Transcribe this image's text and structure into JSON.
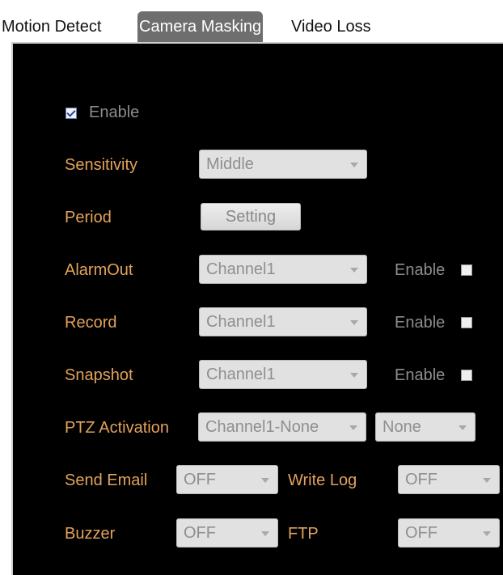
{
  "tabs": [
    {
      "label": "Motion Detect"
    },
    {
      "label": "Camera Masking"
    },
    {
      "label": "Video Loss"
    }
  ],
  "active_tab": "Camera Masking",
  "enable": {
    "label": "Enable",
    "checked": true
  },
  "sensitivity": {
    "label": "Sensitivity",
    "value": "Middle"
  },
  "period": {
    "label": "Period",
    "button": "Setting"
  },
  "alarm_out": {
    "label": "AlarmOut",
    "value": "Channel1",
    "enable_label": "Enable"
  },
  "record": {
    "label": "Record",
    "value": "Channel1",
    "enable_label": "Enable"
  },
  "snapshot": {
    "label": "Snapshot",
    "value": "Channel1",
    "enable_label": "Enable"
  },
  "ptz": {
    "label": "PTZ Activation",
    "value": "Channel1-None",
    "value2": "None"
  },
  "send_email": {
    "label": "Send Email",
    "value": "OFF"
  },
  "write_log": {
    "label": "Write Log",
    "value": "OFF"
  },
  "buzzer": {
    "label": "Buzzer",
    "value": "OFF"
  },
  "ftp": {
    "label": "FTP",
    "value": "OFF"
  },
  "colors": {
    "label": "#e3a25a",
    "panel": "#000000",
    "active_tab": "#6e6e6e"
  }
}
